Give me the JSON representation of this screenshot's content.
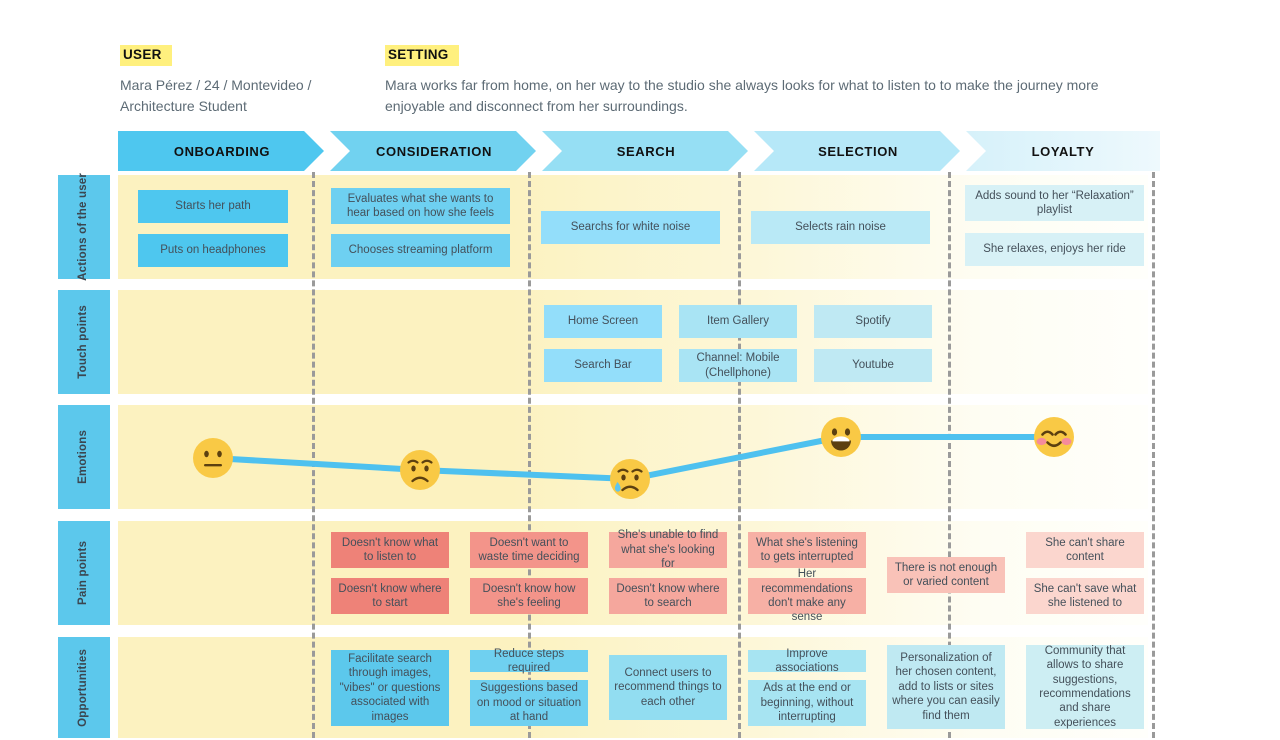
{
  "header": {
    "user": {
      "title": "USER",
      "body": "Mara Pérez / 24 / Montevideo / Architecture Student"
    },
    "setting": {
      "title": "SETTING",
      "body": "Mara works far from home, on her way to the studio she always looks for what to listen to to make the journey more enjoyable and disconnect from her surroundings."
    }
  },
  "colors": {
    "accent_blue": "#5cc8ec",
    "band_cream": "#fdf6cf",
    "pain_red": "#ee8278",
    "highlight_yellow": "#fff07e"
  },
  "stages": [
    {
      "label": "ONBOARDING"
    },
    {
      "label": "CONSIDERATION"
    },
    {
      "label": "SEARCH"
    },
    {
      "label": "SELECTION"
    },
    {
      "label": "LOYALTY"
    }
  ],
  "rows": [
    {
      "label": "Actions of the user"
    },
    {
      "label": "Touch points"
    },
    {
      "label": "Emotions"
    },
    {
      "label": "Pain points"
    },
    {
      "label": "Opportunities"
    }
  ],
  "actions": [
    {
      "text": "Starts her path"
    },
    {
      "text": "Puts on headphones"
    },
    {
      "text": "Evaluates what she wants to hear based on how she feels"
    },
    {
      "text": "Chooses streaming platform"
    },
    {
      "text": "Searchs for white noise"
    },
    {
      "text": "Selects rain noise"
    },
    {
      "text": "Adds sound to her “Relaxation” playlist"
    },
    {
      "text": "She relaxes, enjoys her ride"
    }
  ],
  "touchpoints": [
    {
      "text": "Home Screen"
    },
    {
      "text": "Search Bar"
    },
    {
      "text": "Item Gallery"
    },
    {
      "text": "Channel: Mobile (Chellphone)"
    },
    {
      "text": "Spotify"
    },
    {
      "text": "Youtube"
    }
  ],
  "emotions": {
    "faces": [
      {
        "type": "neutral-face",
        "stage": "ONBOARDING"
      },
      {
        "type": "worried-face",
        "stage": "CONSIDERATION"
      },
      {
        "type": "sad-sweat-face",
        "stage": "SEARCH"
      },
      {
        "type": "grinning-face",
        "stage": "SELECTION"
      },
      {
        "type": "relieved-blush-face",
        "stage": "LOYALTY"
      }
    ]
  },
  "painpoints": [
    {
      "text": "Doesn't know what to listen to"
    },
    {
      "text": "Doesn't know where to start"
    },
    {
      "text": "Doesn't want to waste time deciding"
    },
    {
      "text": "Doesn't know how she's feeling"
    },
    {
      "text": "She's unable to find what she's looking for"
    },
    {
      "text": "Doesn't know where to search"
    },
    {
      "text": "What she's listening to gets interrupted"
    },
    {
      "text": "Her recommendations don't make any sense"
    },
    {
      "text": "There is not enough or varied content"
    },
    {
      "text": "She can't share content"
    },
    {
      "text": "She can't save what she listened to"
    }
  ],
  "opportunities": [
    {
      "text": "Facilitate search through images, \"vibes\" or questions associated with images"
    },
    {
      "text": "Reduce steps required"
    },
    {
      "text": "Suggestions based on mood or situation at hand"
    },
    {
      "text": "Connect users to recommend things to each other"
    },
    {
      "text": "Improve associations"
    },
    {
      "text": "Ads at the end or beginning, without interrupting"
    },
    {
      "text": "Personalization of her chosen content, add to lists or sites where you can easily find them"
    },
    {
      "text": "Community that allows to share suggestions, recommendations and share experiences"
    }
  ],
  "chart_data": {
    "type": "line",
    "title": "Emotions",
    "categories": [
      "ONBOARDING",
      "CONSIDERATION",
      "SEARCH",
      "SELECTION",
      "LOYALTY"
    ],
    "values": [
      3,
      2.4,
      2,
      4.2,
      4.2
    ],
    "labels": [
      "neutral",
      "worried",
      "sad",
      "happy",
      "relieved"
    ],
    "ylim": [
      1,
      5
    ],
    "grid": false,
    "legend": "none",
    "xlabel": "",
    "ylabel": ""
  }
}
